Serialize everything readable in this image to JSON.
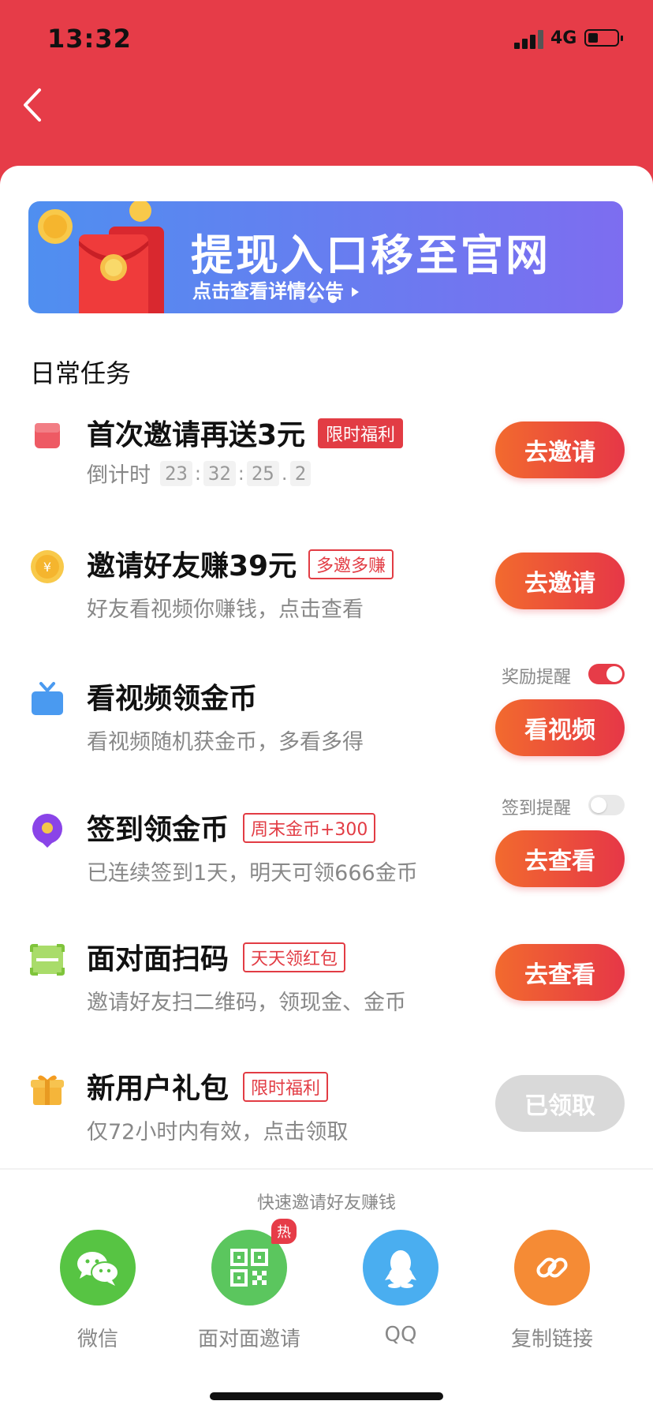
{
  "status_bar": {
    "time": "13:32",
    "network": "4G"
  },
  "banner": {
    "title": "提现入口移至官网",
    "subtitle": "点击查看详情公告"
  },
  "section_title": "日常任务",
  "tasks": [
    {
      "name": "首次邀请再送3元",
      "badge": "限时福利",
      "countdown_label": "倒计时",
      "countdown": [
        "23",
        "32",
        "25",
        "2"
      ],
      "button": "去邀请"
    },
    {
      "name": "邀请好友赚39元",
      "badge": "多邀多赚",
      "desc": "好友看视频你赚钱，点击查看",
      "button": "去邀请"
    },
    {
      "name": "看视频领金币",
      "desc": "看视频随机获金币，多看多得",
      "toggle_label": "奖励提醒",
      "toggle_on": true,
      "button": "看视频"
    },
    {
      "name": "签到领金币",
      "badge": "周末金币+300",
      "desc": "已连续签到1天，明天可领666金币",
      "toggle_label": "签到提醒",
      "toggle_on": false,
      "button": "去查看"
    },
    {
      "name": "面对面扫码",
      "badge": "天天领红包",
      "desc": "邀请好友扫二维码，领现金、金币",
      "button": "去查看"
    },
    {
      "name": "新用户礼包",
      "badge": "限时福利",
      "desc": "仅72小时内有效，点击领取",
      "button": "已领取"
    }
  ],
  "share": {
    "title": "快速邀请好友赚钱",
    "items": [
      {
        "label": "微信",
        "color": "#57c443"
      },
      {
        "label": "面对面邀请",
        "color": "#5bc65e",
        "badge": "热"
      },
      {
        "label": "QQ",
        "color": "#4aaef0"
      },
      {
        "label": "复制链接",
        "color": "#f58b35"
      }
    ]
  },
  "colors": {
    "brand_red": "#e63c48",
    "button_gradient_start": "#f26a2e",
    "button_gradient_end": "#e63747",
    "banner_start": "#4f8ff0",
    "banner_end": "#7d6df0"
  }
}
